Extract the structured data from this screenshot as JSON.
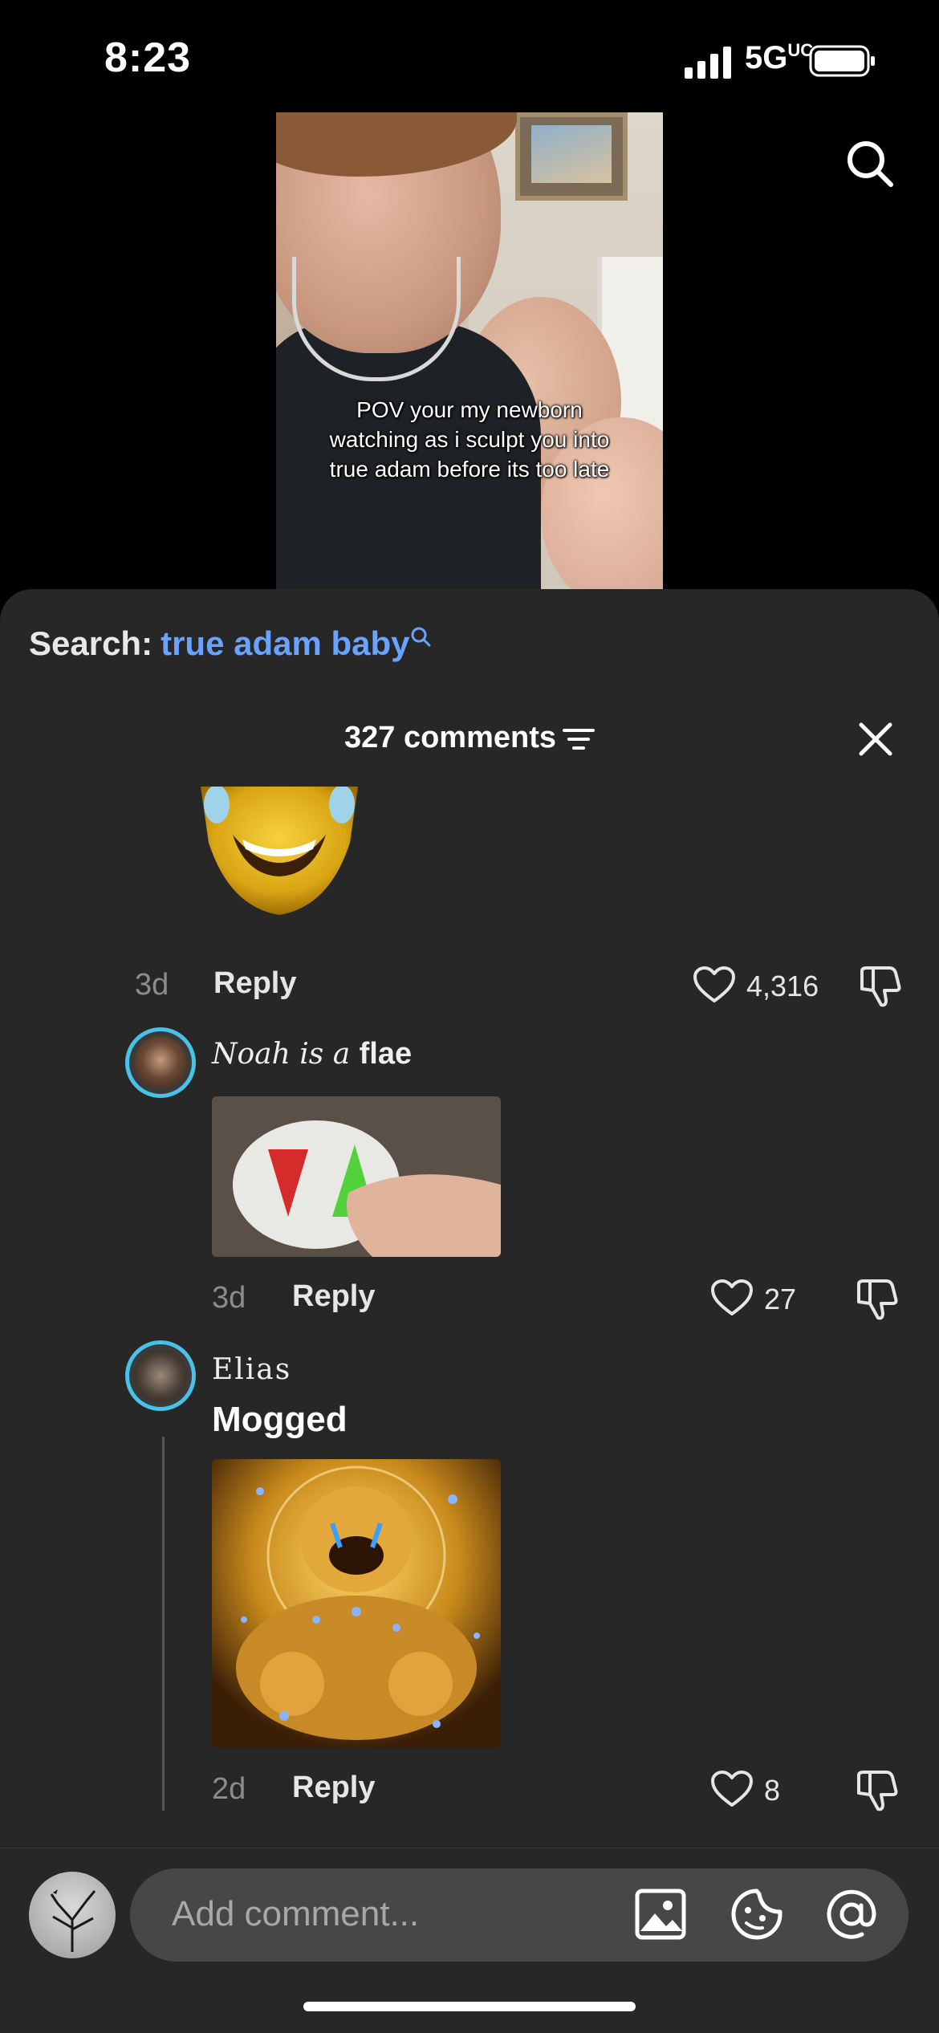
{
  "status_bar": {
    "time": "8:23",
    "network": "5G",
    "network_sup": "UC"
  },
  "video": {
    "caption_lines": [
      "POV your my newborn",
      "watching as i sculpt you into",
      "true adam before its too late"
    ]
  },
  "sheet": {
    "search_label": "Search:",
    "search_query": "true adam baby",
    "comments_title": "327 comments"
  },
  "comments": [
    {
      "age": "3d",
      "reply_label": "Reply",
      "likes": "4,316",
      "image": "golden-laughing-mask"
    },
    {
      "username_script": "Noah is a",
      "username_bold": "flae",
      "image": "red-green-button",
      "age": "3d",
      "reply_label": "Reply",
      "likes": "27"
    },
    {
      "username": "Elias",
      "text": "Mogged",
      "image": "golden-laughing-statue",
      "age": "2d",
      "reply_label": "Reply",
      "likes": "8"
    }
  ],
  "composer": {
    "placeholder": "Add comment..."
  },
  "colors": {
    "accent": "#6aa3ff",
    "sheet_bg": "#272727",
    "avatar_ring": "#48c2e6"
  }
}
